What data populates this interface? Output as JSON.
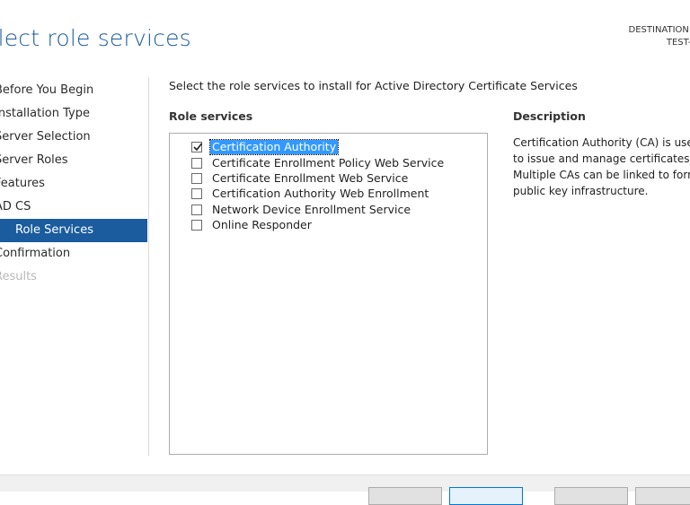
{
  "header": {
    "title": "elect role services",
    "destination_label": "DESTINATION SERV",
    "destination_server": "TEST-Root("
  },
  "nav": {
    "items": [
      {
        "label": "Before You Begin",
        "state": "normal"
      },
      {
        "label": "Installation Type",
        "state": "normal"
      },
      {
        "label": "Server Selection",
        "state": "normal"
      },
      {
        "label": "Server Roles",
        "state": "normal"
      },
      {
        "label": "Features",
        "state": "normal"
      },
      {
        "label": "AD CS",
        "state": "normal"
      },
      {
        "label": "Role Services",
        "state": "active"
      },
      {
        "label": "Confirmation",
        "state": "normal"
      },
      {
        "label": "Results",
        "state": "disabled"
      }
    ]
  },
  "main": {
    "intro": "Select the role services to install for Active Directory Certificate Services",
    "role_services_header": "Role services",
    "description_header": "Description",
    "role_services": [
      {
        "label": "Certification Authority",
        "checked": true,
        "selected": true
      },
      {
        "label": "Certificate Enrollment Policy Web Service",
        "checked": false,
        "selected": false
      },
      {
        "label": "Certificate Enrollment Web Service",
        "checked": false,
        "selected": false
      },
      {
        "label": "Certification Authority Web Enrollment",
        "checked": false,
        "selected": false
      },
      {
        "label": "Network Device Enrollment Service",
        "checked": false,
        "selected": false
      },
      {
        "label": "Online Responder",
        "checked": false,
        "selected": false
      }
    ],
    "description_lines": [
      "Certification Authority (CA) is used",
      "to issue and manage certificates.",
      "Multiple CAs can be linked to form",
      "public key infrastructure."
    ]
  },
  "colors": {
    "accent": "#1a5c9e",
    "selection": "#3399ff"
  }
}
